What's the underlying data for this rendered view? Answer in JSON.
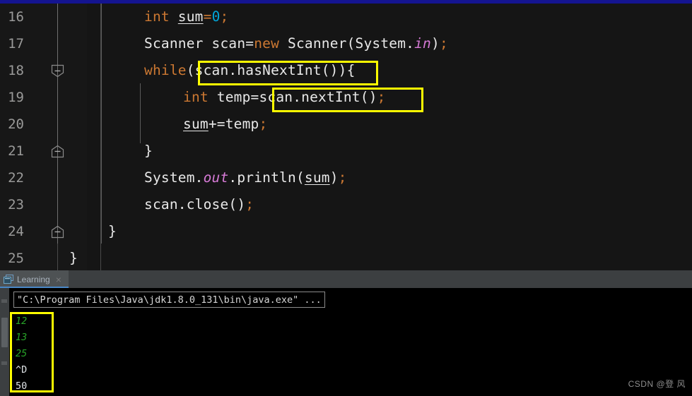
{
  "theme": {
    "accent_bar": "#141490",
    "editor_bg": "#151515",
    "gutter_bg": "#171717",
    "panel_bg": "#3c3f41",
    "console_bg": "#000000",
    "annotation_color": "#ffff00",
    "keyword_color": "#cc7832",
    "number_color": "#00a5d8",
    "field_color": "#d67ad6",
    "text_color": "#d8d8d8",
    "tab_underline": "#4a88c7",
    "console_input_color": "#28a428"
  },
  "editor": {
    "line_numbers": [
      "16",
      "17",
      "18",
      "19",
      "20",
      "21",
      "22",
      "23",
      "24",
      "25"
    ],
    "lines": [
      {
        "n": "16",
        "indent": 61,
        "tokens": [
          {
            "t": "int",
            "c": "kw"
          },
          {
            "t": " ",
            "c": "plain"
          },
          {
            "t": "sum",
            "c": "underline"
          },
          {
            "t": "=",
            "c": "punc"
          },
          {
            "t": "0",
            "c": "num"
          },
          {
            "t": ";",
            "c": "punc"
          }
        ]
      },
      {
        "n": "17",
        "indent": 61,
        "tokens": [
          {
            "t": "Scanner scan=",
            "c": "plain"
          },
          {
            "t": "new",
            "c": "kw"
          },
          {
            "t": " Scanner(System.",
            "c": "plain"
          },
          {
            "t": "in",
            "c": "field"
          },
          {
            "t": ")",
            "c": "plain"
          },
          {
            "t": ";",
            "c": "punc"
          }
        ]
      },
      {
        "n": "18",
        "indent": 61,
        "tokens": [
          {
            "t": "while",
            "c": "kw"
          },
          {
            "t": "(scan.hasNextInt()){",
            "c": "plain"
          }
        ]
      },
      {
        "n": "19",
        "indent": 116,
        "tokens": [
          {
            "t": "int",
            "c": "kw"
          },
          {
            "t": " temp=scan.nextInt()",
            "c": "plain"
          },
          {
            "t": ";",
            "c": "punc"
          }
        ]
      },
      {
        "n": "20",
        "indent": 116,
        "tokens": [
          {
            "t": "sum",
            "c": "underline"
          },
          {
            "t": "+=temp",
            "c": "plain"
          },
          {
            "t": ";",
            "c": "punc"
          }
        ]
      },
      {
        "n": "21",
        "indent": 61,
        "tokens": [
          {
            "t": "}",
            "c": "plain"
          }
        ]
      },
      {
        "n": "22",
        "indent": 61,
        "tokens": [
          {
            "t": "System.",
            "c": "plain"
          },
          {
            "t": "out",
            "c": "field"
          },
          {
            "t": ".println(",
            "c": "plain"
          },
          {
            "t": "sum",
            "c": "underline"
          },
          {
            "t": ")",
            "c": "plain"
          },
          {
            "t": ";",
            "c": "punc"
          }
        ]
      },
      {
        "n": "23",
        "indent": 61,
        "tokens": [
          {
            "t": "scan.close()",
            "c": "plain"
          },
          {
            "t": ";",
            "c": "punc"
          }
        ]
      },
      {
        "n": "24",
        "indent": 10,
        "tokens": [
          {
            "t": "}",
            "c": "plain"
          }
        ]
      },
      {
        "n": "25",
        "indent": -45,
        "tokens": [
          {
            "t": "}",
            "c": "plain"
          }
        ]
      }
    ],
    "fold_markers": [
      {
        "name": "fold-collapse-line-18",
        "line": "18",
        "dir": "down"
      },
      {
        "name": "fold-collapse-line-21",
        "line": "21",
        "dir": "up"
      },
      {
        "name": "fold-collapse-line-24",
        "line": "24",
        "dir": "up"
      }
    ],
    "annotations": [
      {
        "name": "highlight-has-next-int",
        "target": "scan.hasNextInt()"
      },
      {
        "name": "highlight-next-int",
        "target": "scan.nextInt();"
      },
      {
        "name": "highlight-console-output",
        "target": "console output block"
      }
    ]
  },
  "console": {
    "tab": {
      "label": "Learning",
      "icon": "console-window-icon",
      "close": "×"
    },
    "command_line": "\"C:\\Program Files\\Java\\jdk1.8.0_131\\bin\\java.exe\" ...",
    "output": [
      {
        "text": "12",
        "kind": "input"
      },
      {
        "text": "13",
        "kind": "input"
      },
      {
        "text": "25",
        "kind": "input"
      },
      {
        "text": "^D",
        "kind": "system"
      },
      {
        "text": "50",
        "kind": "system"
      }
    ]
  },
  "watermark": "CSDN @登 风"
}
